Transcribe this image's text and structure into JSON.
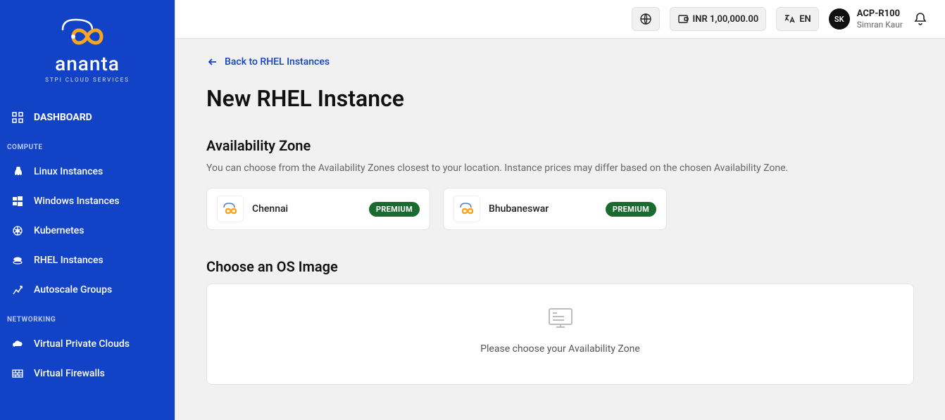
{
  "brand": {
    "name": "ananta",
    "tag": "STPI CLOUD SERVICES"
  },
  "sidebar": {
    "dashboard": "DASHBOARD",
    "sections": {
      "compute": "COMPUTE",
      "networking": "NETWORKING"
    },
    "items": {
      "linux": "Linux Instances",
      "windows": "Windows Instances",
      "kubernetes": "Kubernetes",
      "rhel": "RHEL Instances",
      "autoscale": "Autoscale Groups",
      "vpc": "Virtual Private Clouds",
      "firewalls": "Virtual Firewalls"
    }
  },
  "topbar": {
    "balance": "INR 1,00,000.00",
    "lang": "EN",
    "avatar": "SK",
    "account": "ACP-R100",
    "user": "Simran Kaur"
  },
  "page": {
    "back": "Back to RHEL Instances",
    "title": "New RHEL Instance",
    "az": {
      "title": "Availability Zone",
      "desc": "You can choose from the Availability Zones closest to your location. Instance prices may differ based on the chosen Availability Zone.",
      "zones": {
        "chennai": {
          "name": "Chennai",
          "badge": "PREMIUM"
        },
        "bhubaneswar": {
          "name": "Bhubaneswar",
          "badge": "PREMIUM"
        }
      }
    },
    "os": {
      "title": "Choose an OS Image",
      "placeholder": "Please choose your Availability Zone"
    }
  },
  "colors": {
    "primary": "#1243c6",
    "badge": "#1a6b2f"
  }
}
